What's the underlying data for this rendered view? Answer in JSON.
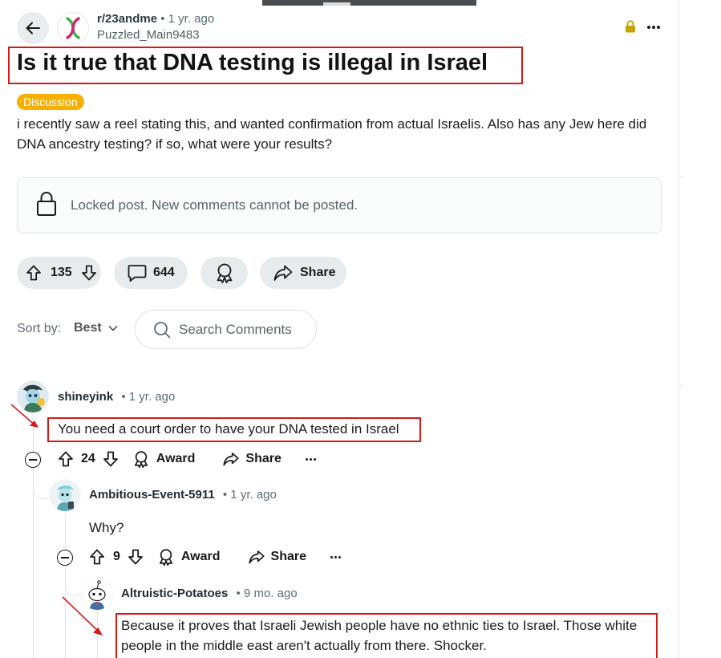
{
  "post": {
    "subreddit": "r/23andme",
    "age": "• 1 yr. ago",
    "author": "Puzzled_Main9483",
    "title": "Is it true that DNA testing is illegal in Israel",
    "flair": "Discussion",
    "body": "i recently saw a reel stating this, and wanted confirmation from actual Israelis. Also has any Jew here did DNA ancestry testing? if so, what were your results?",
    "locked_notice": "Locked post. New comments cannot be posted.",
    "votes": "135",
    "comments_count": "644",
    "share_label": "Share"
  },
  "sort": {
    "label": "Sort by:",
    "value": "Best",
    "search_placeholder": "Search Comments"
  },
  "comments": [
    {
      "author": "shineyink",
      "age": "• 1 yr. ago",
      "body": "You need a court order to have your DNA tested in Israel",
      "votes": "24",
      "award_label": "Award",
      "share_label": "Share"
    },
    {
      "author": "Ambitious-Event-5911",
      "age": "• 1 yr. ago",
      "body": "Why?",
      "votes": "9",
      "award_label": "Award",
      "share_label": "Share"
    },
    {
      "author": "Altruistic-Potatoes",
      "age": "• 9 mo. ago",
      "body": "Because it proves that Israeli Jewish people have no ethnic ties to Israel. Those white people in the middle east aren't actually from there. Shocker."
    }
  ],
  "colors": {
    "annotation_red": "#d11b1b",
    "flair_bg": "#f6b100",
    "pill_bg": "#e8ebed"
  }
}
